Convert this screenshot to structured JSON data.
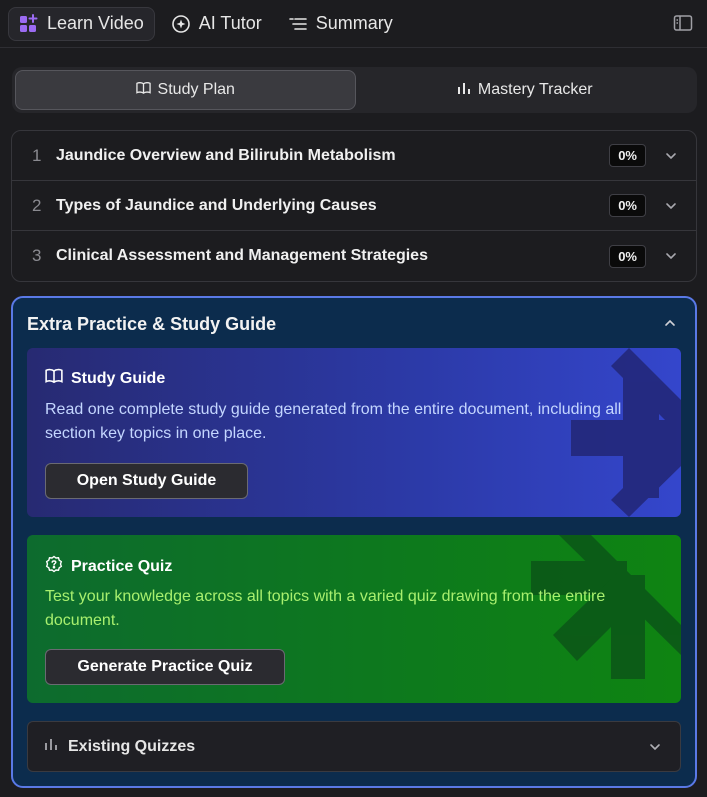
{
  "nav": {
    "tabs": [
      {
        "label": "Learn Video",
        "icon": "sparkle-grid-icon",
        "active": true
      },
      {
        "label": "AI Tutor",
        "icon": "ai-star-icon"
      },
      {
        "label": "Summary",
        "icon": "list-icon"
      }
    ],
    "panel_toggle_icon": "sidebar-toggle-icon"
  },
  "segmented": {
    "study_plan": "Study Plan",
    "mastery_tracker": "Mastery Tracker"
  },
  "sections": [
    {
      "num": "1",
      "title": "Jaundice Overview and Bilirubin Metabolism",
      "progress": "0%"
    },
    {
      "num": "2",
      "title": "Types of Jaundice and Underlying Causes",
      "progress": "0%"
    },
    {
      "num": "3",
      "title": "Clinical Assessment and Management Strategies",
      "progress": "0%"
    }
  ],
  "extra": {
    "title": "Extra Practice & Study Guide",
    "study_guide": {
      "title": "Study Guide",
      "description": "Read one complete study guide generated from the entire document, including all section key topics in one place.",
      "button": "Open Study Guide"
    },
    "practice_quiz": {
      "title": "Practice Quiz",
      "description": "Test your knowledge across all topics with a varied quiz drawing from the entire document.",
      "button": "Generate Practice Quiz"
    },
    "existing_quizzes": "Existing Quizzes"
  },
  "colors": {
    "accent_border": "#5a79e6",
    "guide_gradient_end": "#3446cc",
    "quiz_gradient_end": "#0f8412",
    "quiz_text": "#a8f06e"
  }
}
